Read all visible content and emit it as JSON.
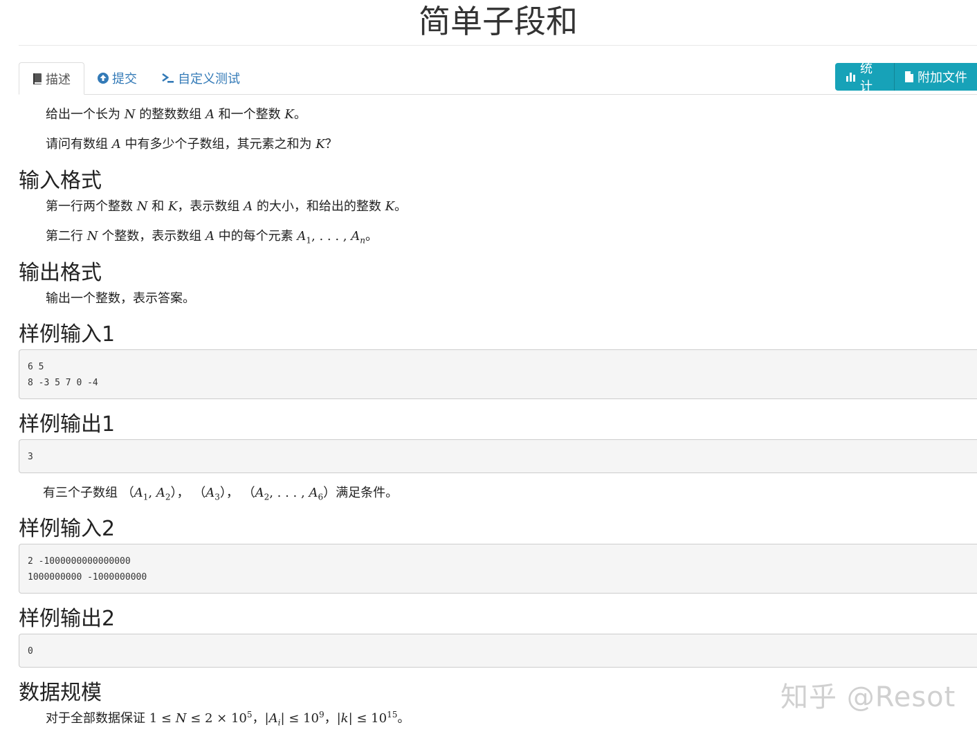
{
  "title": "简单子段和",
  "tabs": [
    {
      "label": "描述",
      "icon": "book-icon"
    },
    {
      "label": "提交",
      "icon": "upload-circle-icon"
    },
    {
      "label": "自定义测试",
      "icon": "terminal-icon"
    }
  ],
  "buttons": {
    "stats_label": "统计",
    "attachments_label": "附加文件"
  },
  "description": {
    "line1": {
      "a": "给出一个长为 ",
      "N": "N",
      "b": " 的整数数组 ",
      "A": "A",
      "c": " 和一个整数 ",
      "K": "K",
      "d": "。"
    },
    "line2": {
      "a": "请问有数组 ",
      "A": "A",
      "b": " 中有多少个子数组，其元素之和为 ",
      "K": "K",
      "c": "？"
    }
  },
  "input_format": {
    "heading": "输入格式",
    "line1": {
      "a": "第一行两个整数 ",
      "N": "N",
      "b": " 和 ",
      "K": "K",
      "c": "，表示数组 ",
      "A": "A",
      "d": " 的大小，和给出的整数 ",
      "K2": "K",
      "e": "。"
    },
    "line2": {
      "a": "第二行 ",
      "N": "N",
      "b": " 个整数，表示数组 ",
      "A": "A",
      "c": " 中的每个元素 ",
      "A1": "A",
      "s1": "1",
      "dots": ", . . . , ",
      "An": "A",
      "sn": "n",
      "d": "。"
    }
  },
  "output_format": {
    "heading": "输出格式",
    "line1": "输出一个整数，表示答案。"
  },
  "sample_input_1": {
    "heading": "样例输入1",
    "lines": [
      "6 5",
      "8 -3 5 7 0 -4"
    ]
  },
  "sample_output_1": {
    "heading": "样例输出1",
    "lines": [
      "3"
    ]
  },
  "explanation": {
    "a": "有三个子数组 （",
    "t1": "A",
    "s1": "1",
    "comma1": ", ",
    "t2": "A",
    "s2": "2",
    "b": "）， （",
    "t3": "A",
    "s3": "3",
    "c": "）， （",
    "t4": "A",
    "s4": "2",
    "dots": ", . . . , ",
    "t5": "A",
    "s5": "6",
    "d": "）满足条件。"
  },
  "sample_input_2": {
    "heading": "样例输入2",
    "lines": [
      "2 -1000000000000000",
      "1000000000 -1000000000"
    ]
  },
  "sample_output_2": {
    "heading": "样例输出2",
    "lines": [
      "0"
    ]
  },
  "constraints": {
    "heading": "数据规模",
    "a": "对于全部数据保证 ",
    "one": "1 ≤ ",
    "N": "N",
    "le": " ≤ 2 × 10",
    "exp5": "5",
    "sep1": "，|",
    "Ai": "A",
    "i": "i",
    "le2": "| ≤ 10",
    "exp9": "9",
    "sep2": "，|",
    "k": "k",
    "le3": "| ≤ 10",
    "exp15": "15",
    "end": "。"
  },
  "watermark": "知乎 @Resot"
}
